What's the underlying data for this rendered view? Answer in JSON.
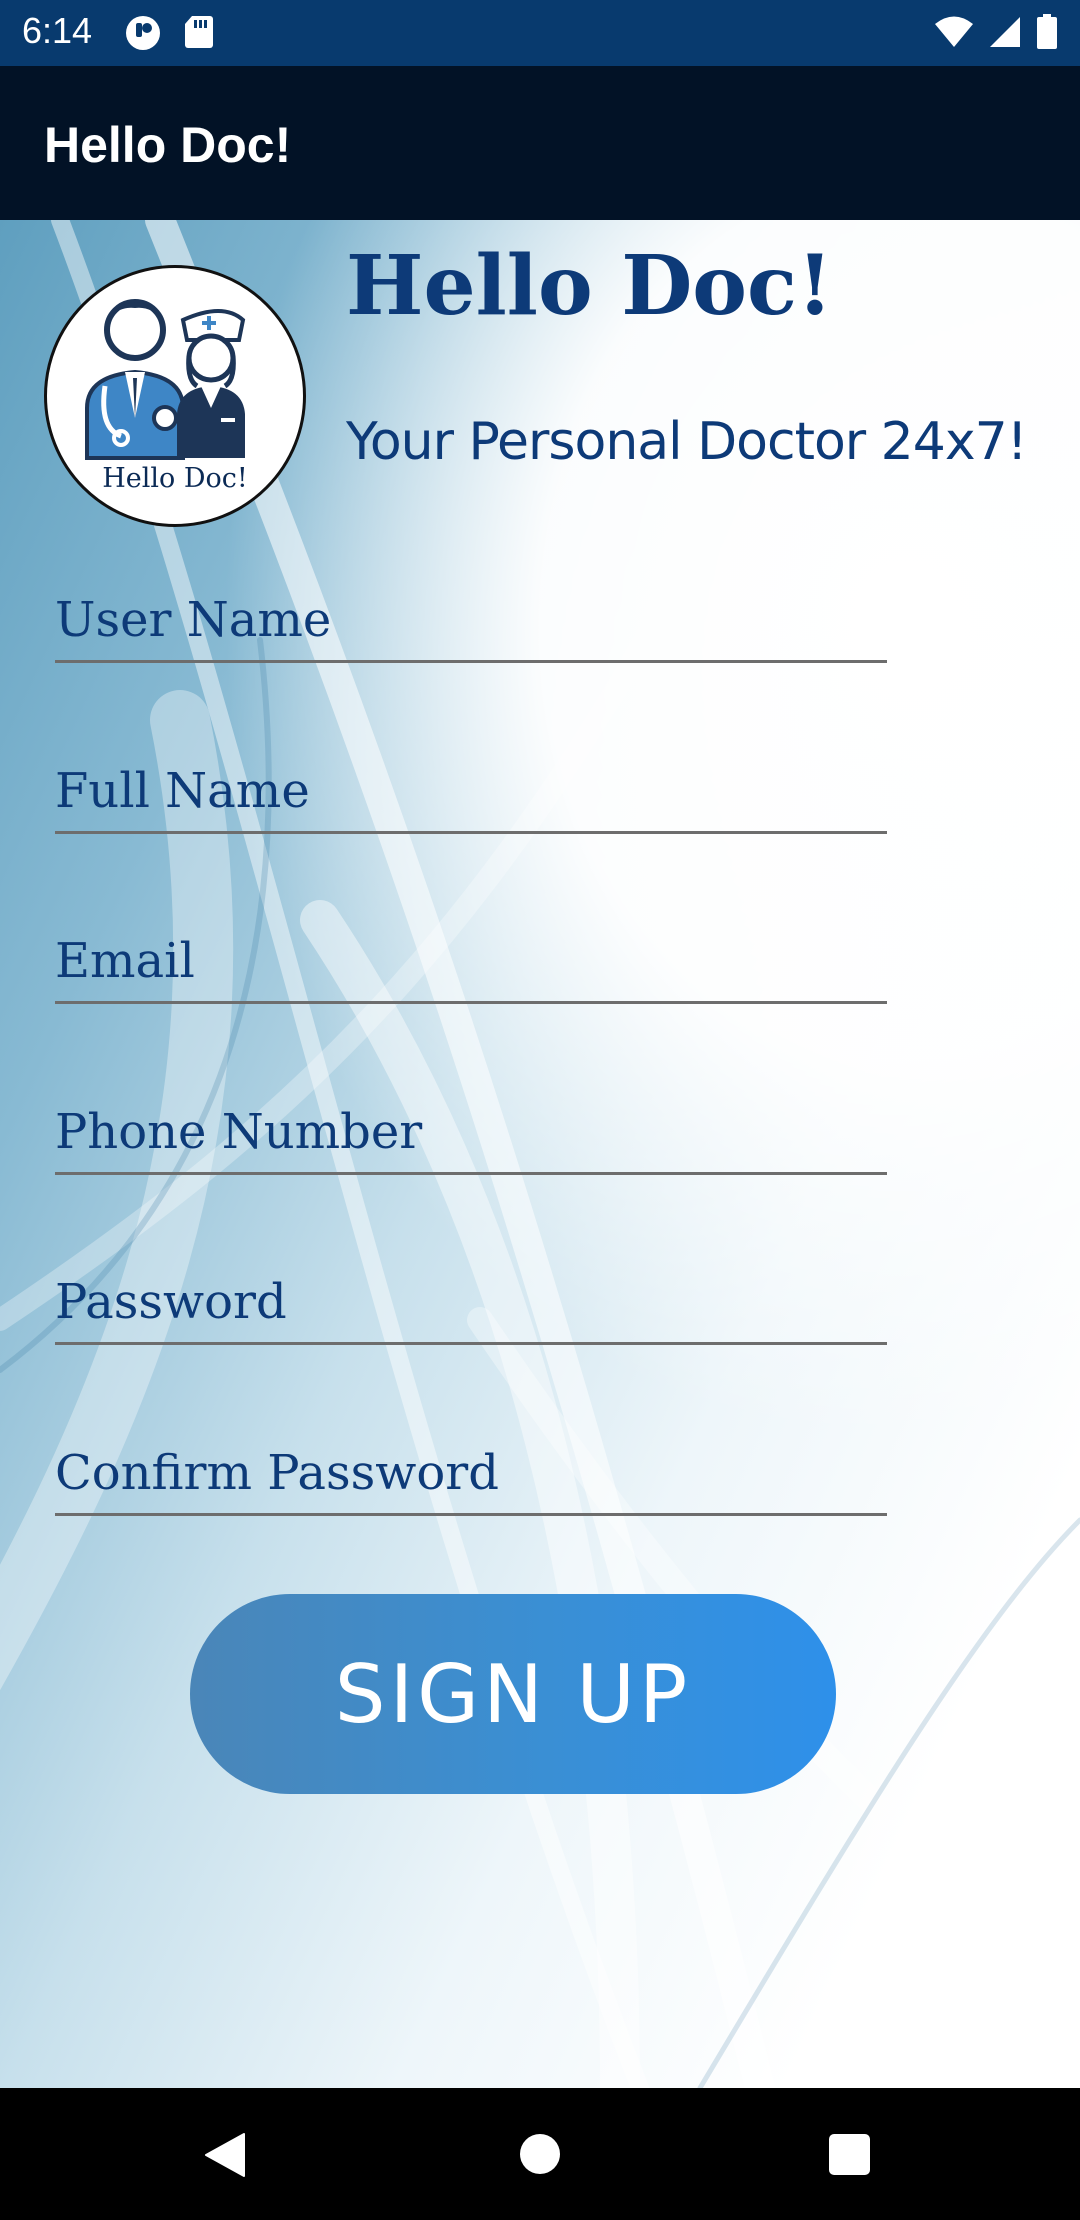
{
  "status_bar": {
    "time": "6:14",
    "left_icons": [
      "notification-icon",
      "sd-card-icon"
    ],
    "right_icons": [
      "wifi-icon",
      "cell-signal-icon",
      "battery-icon"
    ]
  },
  "app_bar": {
    "title": "Hello Doc!"
  },
  "brand": {
    "title": "Hello Doc!",
    "subtitle": "Your Personal Doctor 24x7!",
    "logo_caption": "Hello Doc!"
  },
  "form": {
    "fields": [
      {
        "placeholder": "User Name",
        "value": ""
      },
      {
        "placeholder": "Full Name",
        "value": ""
      },
      {
        "placeholder": "Email",
        "value": ""
      },
      {
        "placeholder": "Phone Number",
        "value": ""
      },
      {
        "placeholder": "Password",
        "value": ""
      },
      {
        "placeholder": "Confirm Password",
        "value": ""
      }
    ],
    "submit_label": "SIGN UP"
  },
  "nav_bar": {
    "icons": [
      "back-icon",
      "home-icon",
      "recents-icon"
    ]
  },
  "colors": {
    "status_bar": "#083a6e",
    "app_bar": "#021226",
    "brand_text": "#0d3a78",
    "button": "#3a8fd4"
  }
}
